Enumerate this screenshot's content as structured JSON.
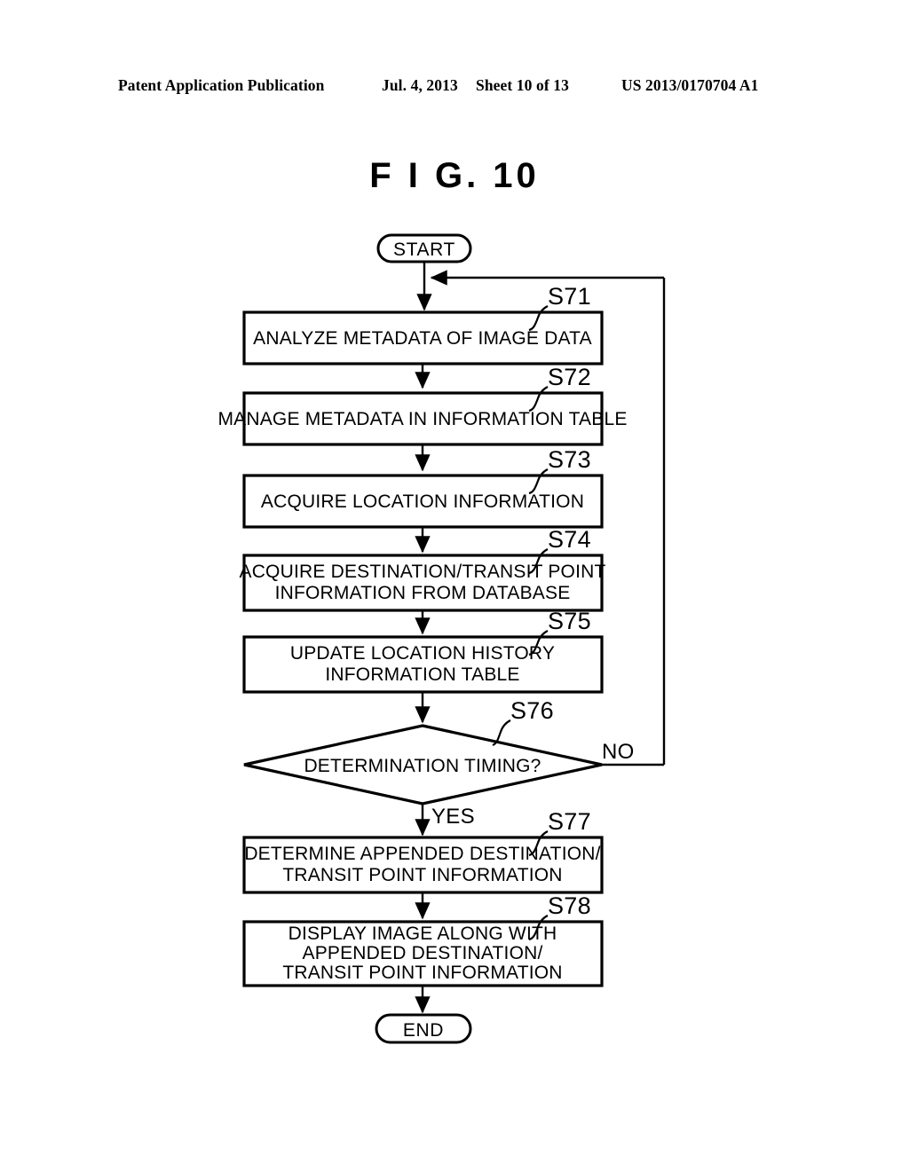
{
  "header": {
    "publication": "Patent Application Publication",
    "date": "Jul. 4, 2013",
    "sheet": "Sheet 10 of 13",
    "patent_number": "US 2013/0170704 A1"
  },
  "figure": {
    "title": "F I G.  10"
  },
  "flowchart": {
    "start_label": "START",
    "end_label": "END",
    "yes_label": "YES",
    "no_label": "NO",
    "steps": [
      {
        "id": "S71",
        "lines": [
          "ANALYZE METADATA OF IMAGE DATA"
        ]
      },
      {
        "id": "S72",
        "lines": [
          "MANAGE METADATA IN INFORMATION TABLE"
        ]
      },
      {
        "id": "S73",
        "lines": [
          "ACQUIRE LOCATION INFORMATION"
        ]
      },
      {
        "id": "S74",
        "lines": [
          "ACQUIRE DESTINATION/TRANSIT POINT",
          "INFORMATION FROM DATABASE"
        ]
      },
      {
        "id": "S75",
        "lines": [
          "UPDATE LOCATION HISTORY",
          "INFORMATION TABLE"
        ]
      },
      {
        "id": "S76",
        "lines": [
          "DETERMINATION TIMING?"
        ]
      },
      {
        "id": "S77",
        "lines": [
          "DETERMINE APPENDED DESTINATION/",
          "TRANSIT POINT INFORMATION"
        ]
      },
      {
        "id": "S78",
        "lines": [
          "DISPLAY IMAGE ALONG WITH",
          "APPENDED DESTINATION/",
          "TRANSIT POINT INFORMATION"
        ]
      }
    ]
  },
  "colors": {
    "ink": "#000000",
    "paper": "#ffffff"
  }
}
